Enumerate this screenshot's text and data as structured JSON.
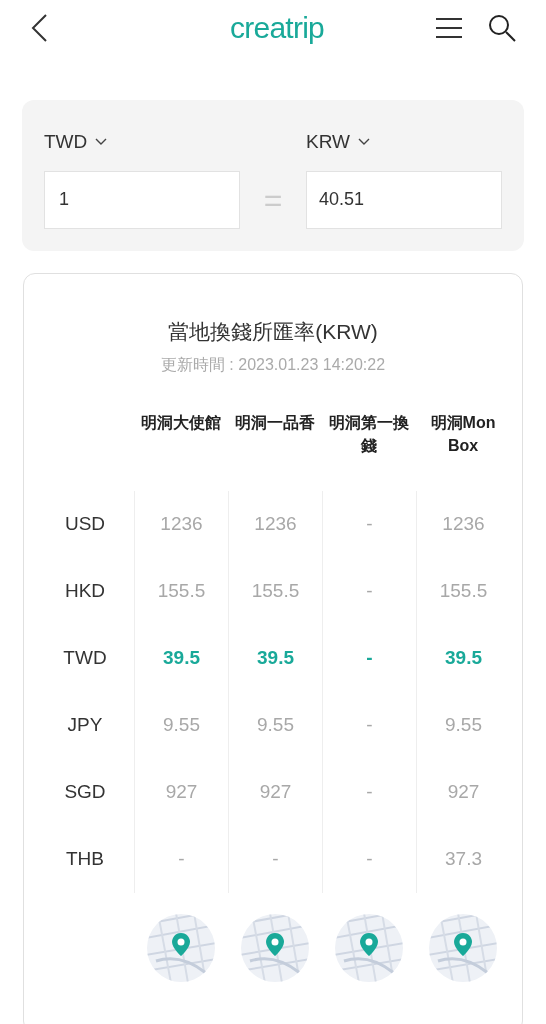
{
  "header": {
    "logo": "creatrip"
  },
  "converter": {
    "from": {
      "currency": "TWD",
      "value": "1"
    },
    "equals": "=",
    "to": {
      "currency": "KRW",
      "value": "40.51"
    }
  },
  "rates": {
    "title": "當地換錢所匯率(KRW)",
    "updated": "更新時間 : 2023.01.23 14:20:22",
    "columns": [
      "明洞大使館",
      "明洞一品香",
      "明洞第一換錢",
      "明洞Mon\nBox"
    ],
    "rows": [
      {
        "currency": "USD",
        "selected": false,
        "values": [
          "1236",
          "1236",
          "-",
          "1236"
        ]
      },
      {
        "currency": "HKD",
        "selected": false,
        "values": [
          "155.5",
          "155.5",
          "-",
          "155.5"
        ]
      },
      {
        "currency": "TWD",
        "selected": true,
        "values": [
          "39.5",
          "39.5",
          "-",
          "39.5"
        ]
      },
      {
        "currency": "JPY",
        "selected": false,
        "values": [
          "9.55",
          "9.55",
          "-",
          "9.55"
        ]
      },
      {
        "currency": "SGD",
        "selected": false,
        "values": [
          "927",
          "927",
          "-",
          "927"
        ]
      },
      {
        "currency": "THB",
        "selected": false,
        "values": [
          "-",
          "-",
          "-",
          "37.3"
        ]
      }
    ]
  }
}
